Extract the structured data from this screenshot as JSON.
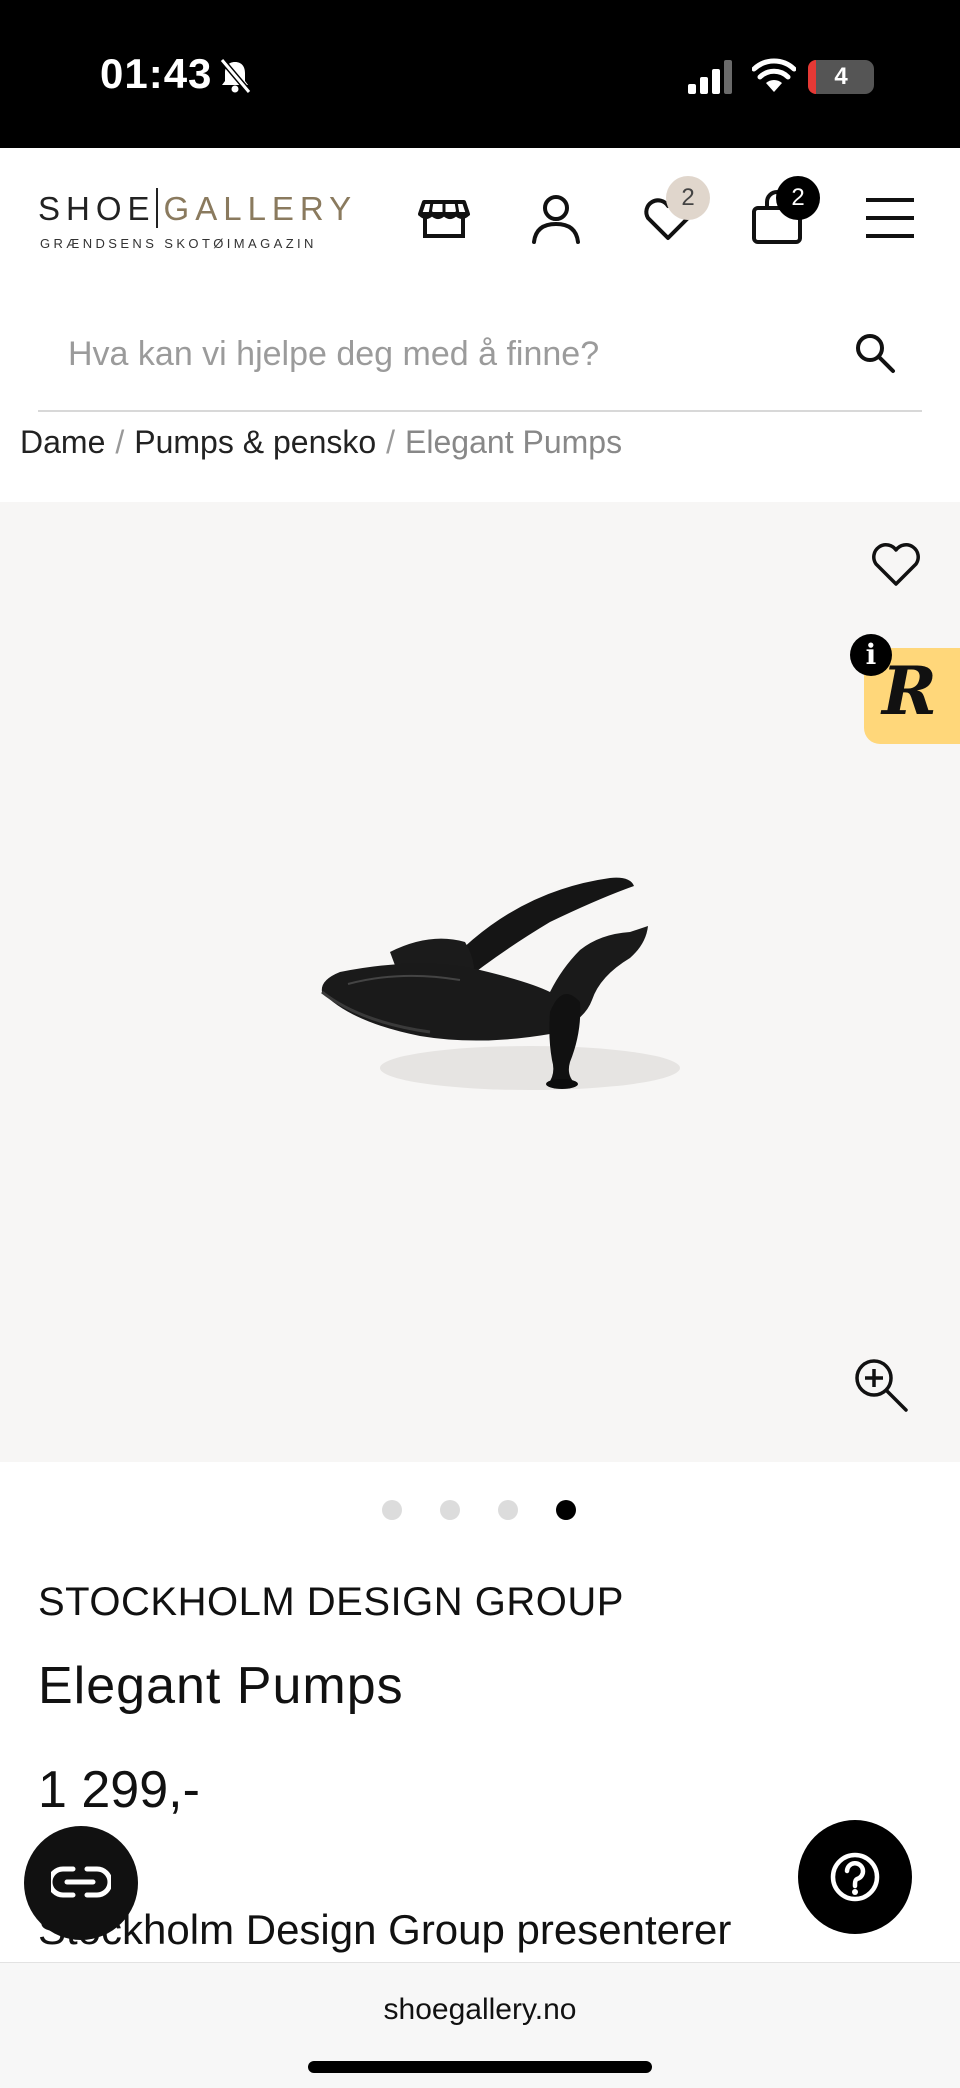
{
  "status_bar": {
    "time": "01:43",
    "battery": "4"
  },
  "header": {
    "logo_left": "SHOE",
    "logo_right": "GALLERY",
    "logo_tagline": "GRÆNDSENS SKOTØIMAGAZIN",
    "wishlist_count": "2",
    "cart_count": "2"
  },
  "search": {
    "placeholder": "Hva kan vi hjelpe deg med å finne?"
  },
  "breadcrumb": {
    "items": [
      "Dame",
      "Pumps & pensko"
    ],
    "current": "Elegant Pumps",
    "separator": "/"
  },
  "gallery": {
    "slide_count": 4,
    "active_slide": 4,
    "badge_letter": "R",
    "info_letter": "i"
  },
  "product": {
    "brand": "STOCKHOLM DESIGN GROUP",
    "name": "Elegant Pumps",
    "price": "1 299,-",
    "description_start": "Stockholm Design Group presenterer"
  },
  "browser": {
    "url": "shoegallery.no"
  },
  "colors": {
    "badge_light": "#e0d6cc",
    "accent_tab": "#ffd77a",
    "logo_gold": "#8a7a5e"
  }
}
